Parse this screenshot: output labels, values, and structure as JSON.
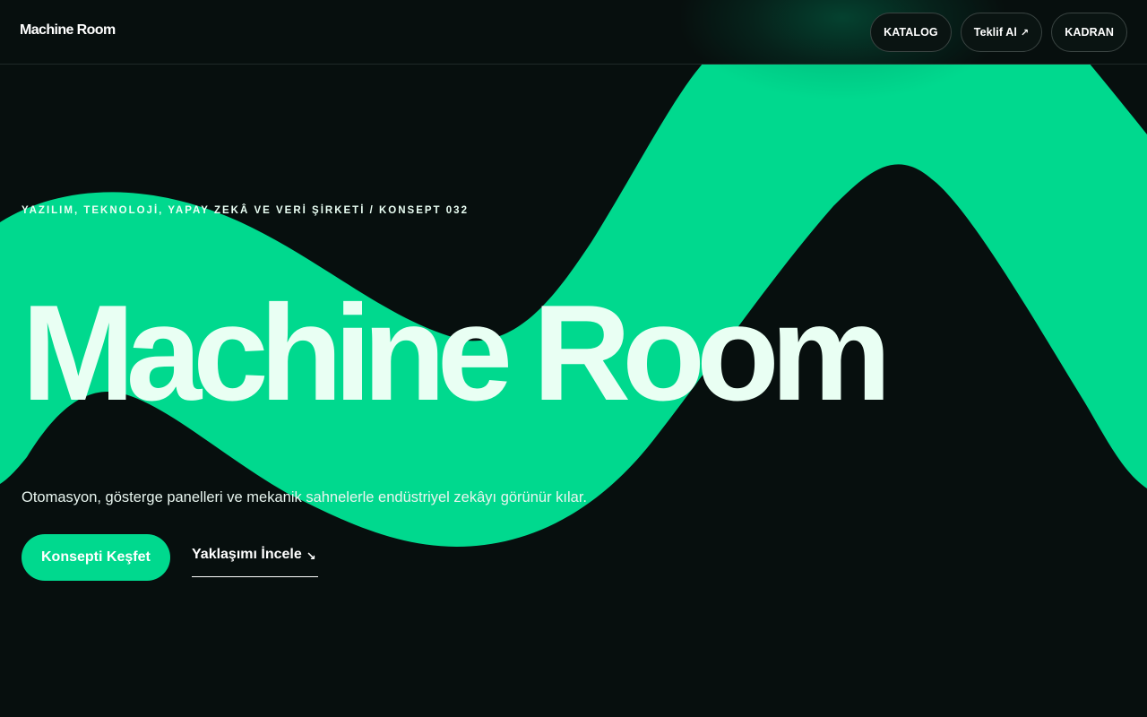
{
  "app": {
    "brand": "Machine Room"
  },
  "nav": {
    "items": [
      {
        "label": "KATALOG",
        "icon": ""
      },
      {
        "label": "Teklif Al",
        "icon": "↗"
      },
      {
        "label": "KADRAN",
        "icon": ""
      }
    ]
  },
  "hero": {
    "eyebrow": "YAZILIM, TEKNOLOJİ, YAPAY ZEKÂ VE VERİ ŞİRKETİ / KONSEPT 032",
    "title": "Machine Room",
    "subtitle": "Otomasyon, gösterge panelleri ve mekanik sahnelerle endüstriyel zekâyı görünür kılar.",
    "primary_cta": "Konsepti Keşfet",
    "secondary_cta": "Yaklaşımı İncele",
    "secondary_cta_icon": "↘"
  },
  "colors": {
    "background": "#070f0e",
    "accent": "#00d98e",
    "text_light": "#e9fff3"
  }
}
